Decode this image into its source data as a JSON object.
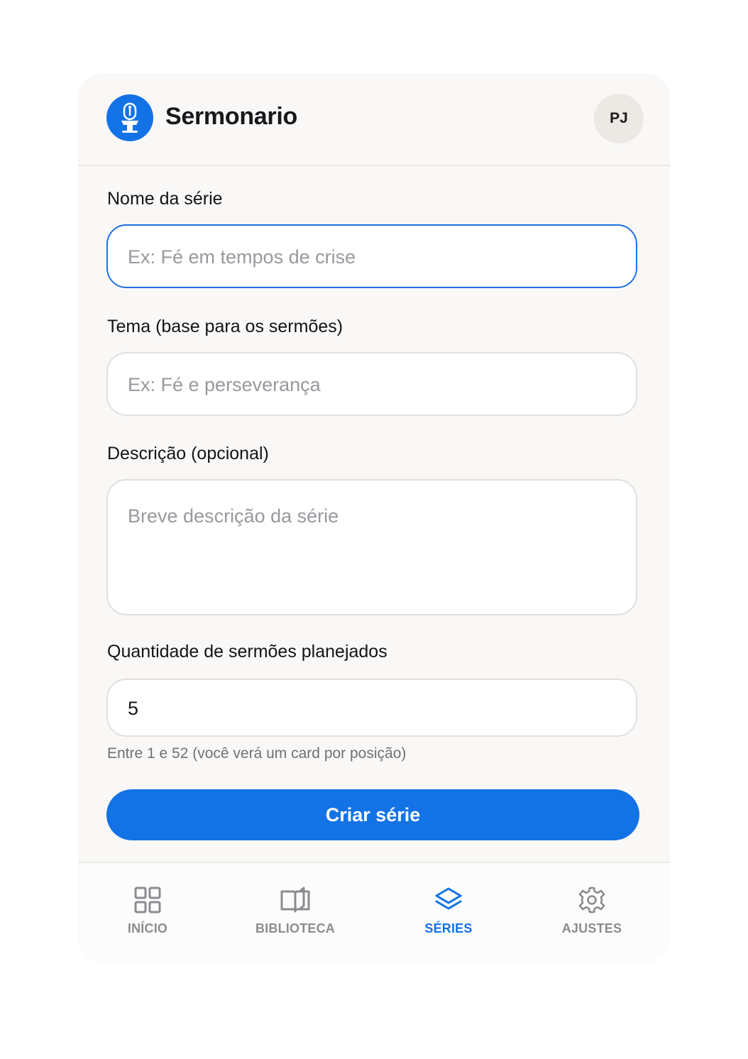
{
  "app": {
    "title": "Sermonario",
    "avatar_initials": "PJ",
    "logo_icon": "microphone-pulpit-icon",
    "accent_color": "#1373e6"
  },
  "form": {
    "series_name": {
      "label": "Nome da série",
      "placeholder": "Ex: Fé em tempos de crise",
      "value": ""
    },
    "theme": {
      "label": "Tema (base para os sermões)",
      "placeholder": "Ex: Fé e perseverança",
      "value": ""
    },
    "description": {
      "label": "Descrição (opcional)",
      "placeholder": "Breve descrição da série",
      "value": ""
    },
    "quantity": {
      "label": "Quantidade de sermões planejados",
      "value": "5",
      "hint": "Entre 1 e 52 (você verá um card por posição)"
    },
    "submit_label": "Criar série"
  },
  "nav": {
    "items": [
      {
        "label": "INÍCIO",
        "icon": "grid-icon",
        "active": false
      },
      {
        "label": "BIBLIOTECA",
        "icon": "book-open-icon",
        "active": false
      },
      {
        "label": "SÉRIES",
        "icon": "layers-icon",
        "active": true
      },
      {
        "label": "AJUSTES",
        "icon": "gear-icon",
        "active": false
      }
    ]
  }
}
